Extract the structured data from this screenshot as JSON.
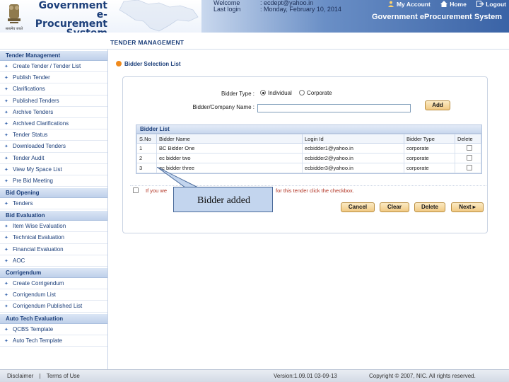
{
  "header": {
    "logo_line1": "Government",
    "logo_line2": "e-Procurement",
    "logo_line3": "System",
    "emblem_caption": "सत्यमेव जयते",
    "welcome_label": "Welcome",
    "welcome_value": ": ecdept@yahoo.in",
    "lastlogin_label": "Last login",
    "lastlogin_value": ": Monday, February 10, 2014",
    "my_account": "My Account",
    "home": "Home",
    "logout": "Logout",
    "system_title": "Government eProcurement System"
  },
  "section_title": "TENDER MANAGEMENT",
  "sidebar": {
    "groups": [
      {
        "title": "Tender Management",
        "items": [
          "Create Tender / Tender List",
          "Publish Tender",
          "Clarifications",
          "Published Tenders",
          "Archive Tenders",
          "Archived Clarifications",
          "Tender Status",
          "Downloaded Tenders",
          "Tender Audit",
          "View My Space List",
          "Pre Bid Meeting"
        ]
      },
      {
        "title": "Bid Opening",
        "items": [
          "Tenders"
        ]
      },
      {
        "title": "Bid Evaluation",
        "items": [
          "Item Wise Evaluation",
          "Technical Evaluation",
          "Financial Evaluation",
          "AOC"
        ]
      },
      {
        "title": "Corrigendum",
        "items": [
          "Create Corrigendum",
          "Corrigendum List",
          "Corrigendum Published List"
        ]
      },
      {
        "title": "Auto Tech Evaluation",
        "items": [
          "QCBS Template",
          "Auto Tech Template"
        ]
      }
    ]
  },
  "main": {
    "sub_title": "Bidder Selection List",
    "bidder_type_label": "Bidder Type :",
    "bidder_type_options": [
      "Individual",
      "Corporate"
    ],
    "bidder_type_selected": "Individual",
    "company_label": "Bidder/Company Name :",
    "company_value": "",
    "add_button": "Add",
    "list_title": "Bidder List",
    "columns": [
      "S.No",
      "Bidder Name",
      "Login Id",
      "Bidder Type",
      "Delete"
    ],
    "rows": [
      [
        "1",
        "BC Bidder One",
        "ecbidder1@yahoo.in",
        "corporate"
      ],
      [
        "2",
        "ec bidder two",
        "ecbidder2@yahoo.in",
        "corporate"
      ],
      [
        "3",
        "ec bidder three",
        "ecbidder3@yahoo.in",
        "corporate"
      ]
    ],
    "agree_text_left": "If you we",
    "agree_text_right": "for this tender click the checkbox.",
    "buttons": {
      "cancel": "Cancel",
      "clear": "Clear",
      "delete": "Delete",
      "next": "Next"
    }
  },
  "callout": {
    "text": "Bidder added"
  },
  "footer": {
    "disclaimer": "Disclaimer",
    "separator": "|",
    "terms": "Terms of Use",
    "version": "Version:1.09.01 03-09-13",
    "copyright": "Copyright © 2007, NIC. All rights reserved."
  },
  "colors": {
    "accent": "#1c3f7a",
    "banner": "#3a63a6",
    "button": "#f1c983",
    "bullet": "#f08a1c"
  }
}
